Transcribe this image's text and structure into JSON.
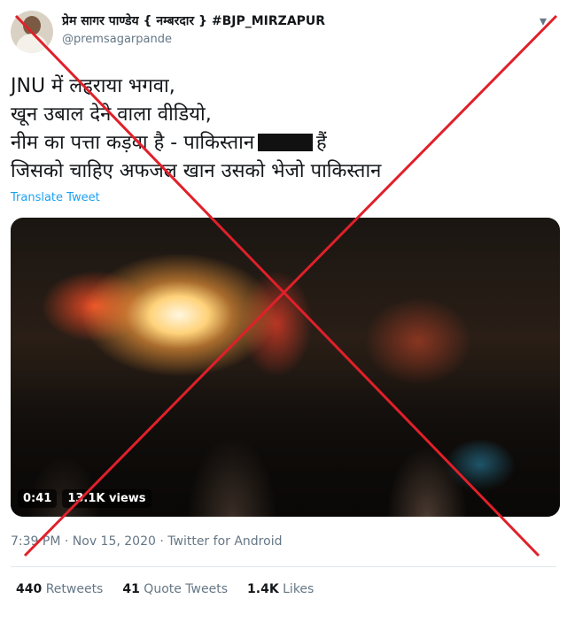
{
  "author": {
    "name": "प्रेम सागर पाण्डेय { नम्बरदार } #BJP_MIRZAPUR",
    "handle": "@premsagarpande"
  },
  "tweet": {
    "lines": [
      "JNU में लहराया भगवा,",
      "खून उबाल देने वाला वीडियो,",
      "नीम का पत्ता कड़वा है - पाकिस्तान",
      "हैं",
      "जिसको चाहिए अफजल खान उसको भेजो पाकिस्तान"
    ],
    "translate_label": "Translate Tweet"
  },
  "video": {
    "duration": "0:41",
    "views": "13.1K views"
  },
  "meta": {
    "time": "7:39 PM",
    "date": "Nov 15, 2020",
    "source": "Twitter for Android",
    "separator": "·"
  },
  "stats": {
    "retweets_count": "440",
    "retweets_label": "Retweets",
    "quote_count": "41",
    "quote_label": "Quote Tweets",
    "likes_count": "1.4K",
    "likes_label": "Likes"
  },
  "icons": {
    "more": "more-options-icon",
    "cross": "red-cross-mark"
  },
  "colors": {
    "link": "#1da1f2",
    "cross": "#e0202a"
  }
}
